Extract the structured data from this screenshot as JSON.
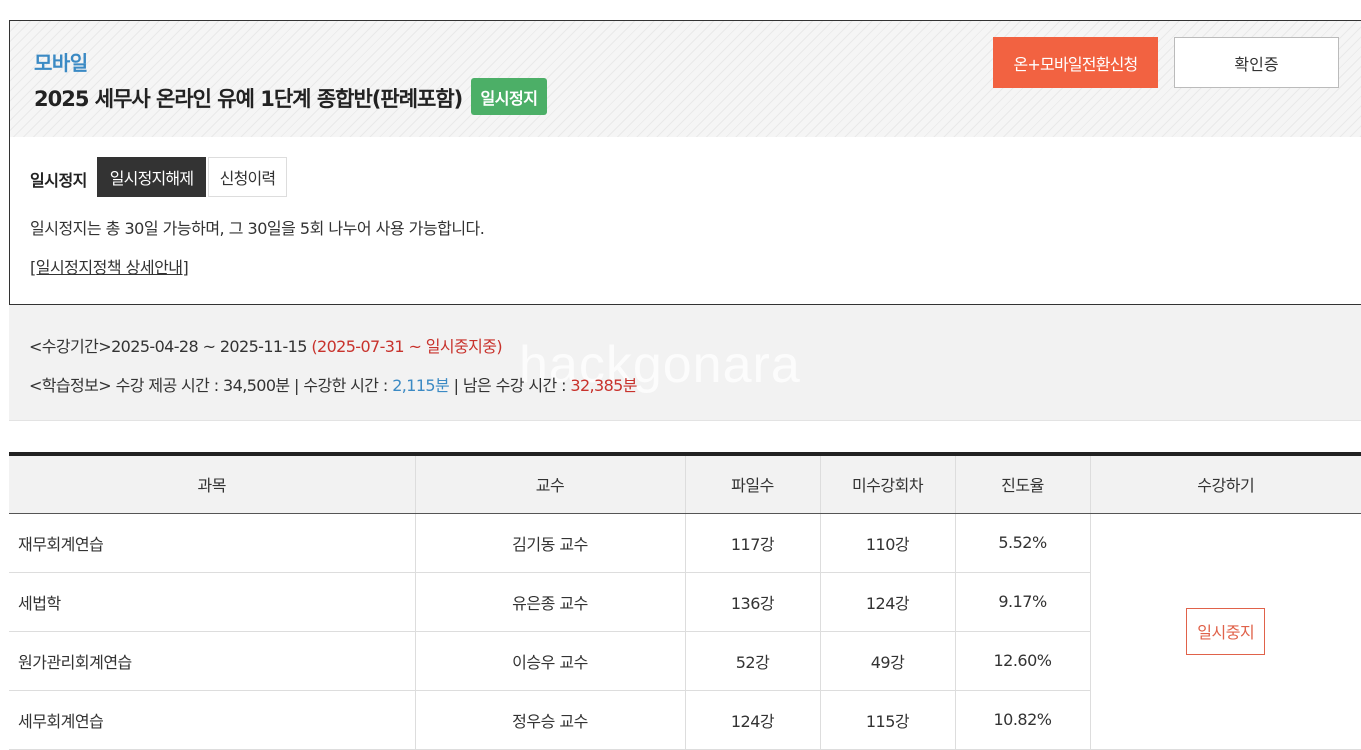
{
  "course": {
    "type": "모바일",
    "title": "2025 세무사 온라인 유예 1단계 종합반(판례포함)",
    "status": "일시정지",
    "convert_button": "온+모바일전환신청",
    "certificate_button": "확인증"
  },
  "pause": {
    "label": "일시정지",
    "release_tab": "일시정지해제",
    "history_tab": "신청이력",
    "description": "일시정지는 총 30일 가능하며, 그 30일을 5회 나누어 사용 가능합니다.",
    "policy_link": "[일시정지정책 상세안내]"
  },
  "info": {
    "period_label": "<수강기간>",
    "period_range": "2025-04-28 ~ 2025-11-15",
    "period_paused": "(2025-07-31 ~ 일시중지중)",
    "study_label": "<학습정보>",
    "provided_time_text": "수강 제공 시간 : 34,500분",
    "sep1": " | ",
    "watched_time_label": "수강한 시간 : ",
    "watched_time_value": "2,115분",
    "sep2": " | ",
    "remaining_time_label": "남은 수강 시간 : ",
    "remaining_time_value": "32,385분",
    "watermark": "hackgonara"
  },
  "table": {
    "headers": {
      "subject": "과목",
      "professor": "교수",
      "files": "파일수",
      "remaining": "미수강회차",
      "progress": "진도율",
      "action": "수강하기"
    },
    "rows": [
      {
        "subject": "재무회계연습",
        "professor": "김기동 교수",
        "files": "117강",
        "remaining": "110강",
        "progress": "5.52%"
      },
      {
        "subject": "세법학",
        "professor": "유은종 교수",
        "files": "136강",
        "remaining": "124강",
        "progress": "9.17%"
      },
      {
        "subject": "원가관리회계연습",
        "professor": "이승우 교수",
        "files": "52강",
        "remaining": "49강",
        "progress": "12.60%"
      },
      {
        "subject": "세무회계연습",
        "professor": "정우승 교수",
        "files": "124강",
        "remaining": "115강",
        "progress": "10.82%"
      }
    ],
    "action_button": "일시중지"
  }
}
